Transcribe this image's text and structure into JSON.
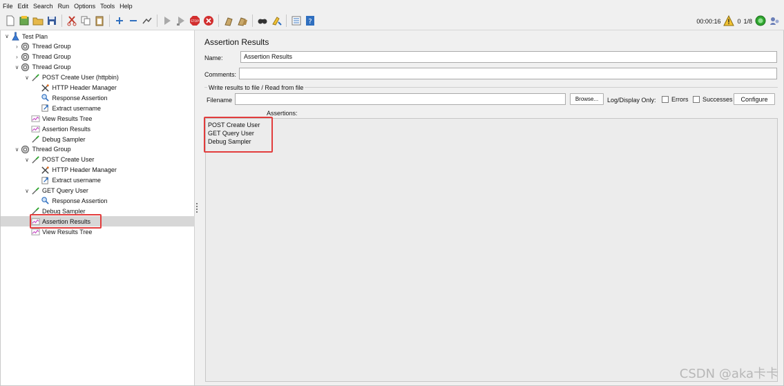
{
  "menu": [
    "File",
    "Edit",
    "Search",
    "Run",
    "Options",
    "Tools",
    "Help"
  ],
  "toolbar_icons": [
    "new-icon",
    "templates-icon",
    "open-icon",
    "save-icon",
    "cut-icon",
    "copy-icon",
    "paste-icon",
    "expand-icon",
    "collapse-icon",
    "toggle-icon",
    "start-icon",
    "start-no-pause-icon",
    "stop-icon",
    "shutdown-icon",
    "clear-icon",
    "clear-all-icon",
    "search-icon",
    "reset-search-icon",
    "function-helper-icon",
    "help-icon"
  ],
  "status": {
    "elapsed": "00:00:16",
    "warnings": "0",
    "threads": "1/8"
  },
  "tree": [
    {
      "label": "Test Plan",
      "level": 0,
      "chevron": "down",
      "icon": "test-plan-icon"
    },
    {
      "label": "Thread Group",
      "level": 1,
      "chevron": "right",
      "icon": "thread-group-icon"
    },
    {
      "label": "Thread Group",
      "level": 1,
      "chevron": "right",
      "icon": "thread-group-icon"
    },
    {
      "label": "Thread Group",
      "level": 1,
      "chevron": "down",
      "icon": "thread-group-icon"
    },
    {
      "label": "POST Create User (httpbin)",
      "level": 2,
      "chevron": "down",
      "icon": "sampler-icon"
    },
    {
      "label": "HTTP Header Manager",
      "level": 3,
      "chevron": "",
      "icon": "header-manager-icon"
    },
    {
      "label": "Response Assertion",
      "level": 3,
      "chevron": "",
      "icon": "assertion-icon"
    },
    {
      "label": "Extract username",
      "level": 3,
      "chevron": "",
      "icon": "extractor-icon"
    },
    {
      "label": "View Results Tree",
      "level": 2,
      "chevron": "",
      "icon": "listener-icon"
    },
    {
      "label": "Assertion Results",
      "level": 2,
      "chevron": "",
      "icon": "listener-icon"
    },
    {
      "label": "Debug Sampler",
      "level": 2,
      "chevron": "",
      "icon": "sampler-icon"
    },
    {
      "label": "Thread Group",
      "level": 1,
      "chevron": "down",
      "icon": "thread-group-icon"
    },
    {
      "label": "POST Create User",
      "level": 2,
      "chevron": "down",
      "icon": "sampler-icon"
    },
    {
      "label": "HTTP Header Manager",
      "level": 3,
      "chevron": "",
      "icon": "header-manager-icon"
    },
    {
      "label": "Extract username",
      "level": 3,
      "chevron": "",
      "icon": "extractor-icon"
    },
    {
      "label": "GET Query User",
      "level": 2,
      "chevron": "down",
      "icon": "sampler-icon"
    },
    {
      "label": "Response Assertion",
      "level": 3,
      "chevron": "",
      "icon": "assertion-icon"
    },
    {
      "label": "Debug Sampler",
      "level": 2,
      "chevron": "",
      "icon": "sampler-icon"
    },
    {
      "label": "Assertion Results",
      "level": 2,
      "chevron": "",
      "icon": "listener-icon",
      "selected": true
    },
    {
      "label": "View Results Tree",
      "level": 2,
      "chevron": "",
      "icon": "listener-icon"
    }
  ],
  "panel": {
    "title": "Assertion Results",
    "name_label": "Name:",
    "name_value": "Assertion Results",
    "comments_label": "Comments:",
    "comments_value": "",
    "file_section": "Write results to file / Read from file",
    "filename_label": "Filename",
    "filename_value": "",
    "browse_label": "Browse...",
    "log_display_label": "Log/Display Only:",
    "errors_label": "Errors",
    "successes_label": "Successes",
    "configure_label": "Configure",
    "assertions_label": "Assertions:",
    "assertions": [
      "POST Create User",
      "GET Query User",
      "Debug Sampler"
    ]
  },
  "watermark": "CSDN @aka卡卡",
  "colors": {
    "highlight": "#e23c3c",
    "selected_row": "#d7d7d7"
  }
}
